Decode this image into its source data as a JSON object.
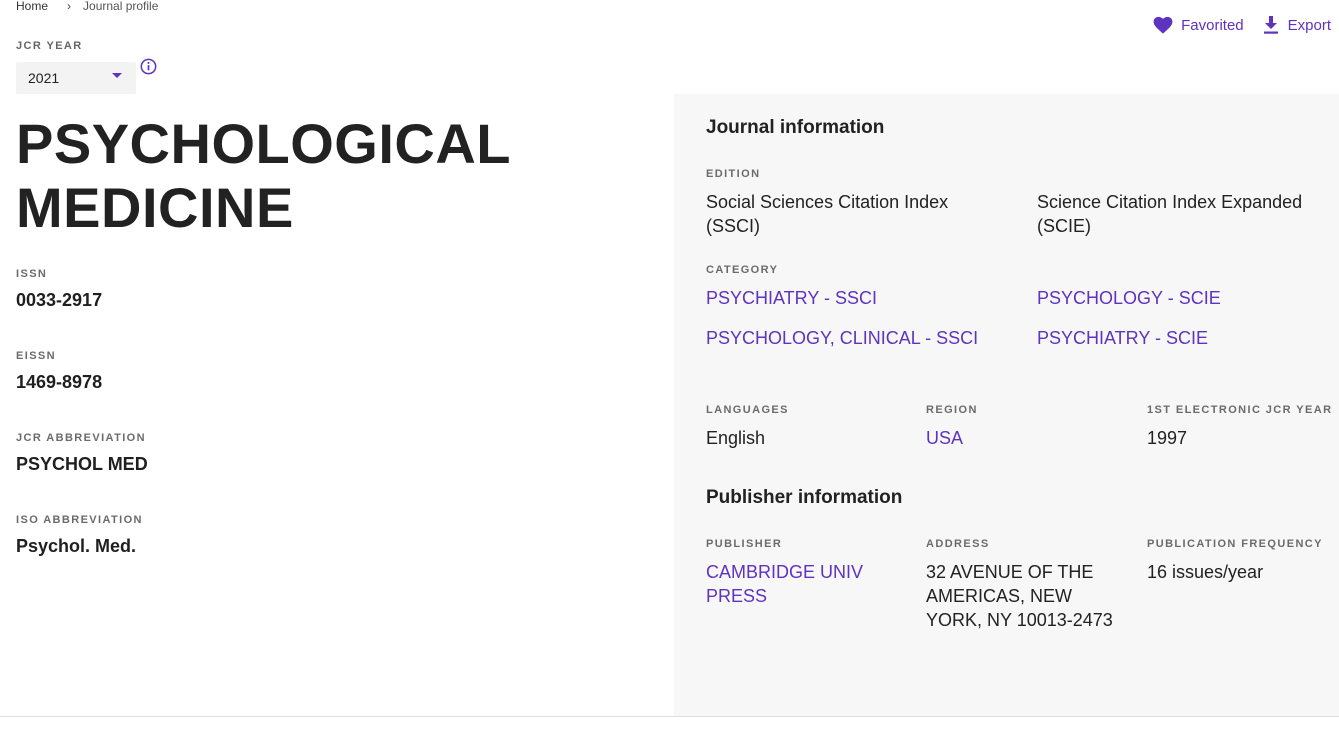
{
  "breadcrumb": {
    "home": "Home",
    "separator": "›",
    "current": "Journal profile"
  },
  "actions": {
    "favorited": "Favorited",
    "export": "Export"
  },
  "jcr_year": {
    "label": "JCR YEAR",
    "value": "2021"
  },
  "journal": {
    "title": "PSYCHOLOGICAL MEDICINE",
    "issn_label": "ISSN",
    "issn": "0033-2917",
    "eissn_label": "EISSN",
    "eissn": "1469-8978",
    "jcr_abbrev_label": "JCR ABBREVIATION",
    "jcr_abbrev": "PSYCHOL MED",
    "iso_abbrev_label": "ISO ABBREVIATION",
    "iso_abbrev": "Psychol. Med."
  },
  "journal_info": {
    "heading": "Journal information",
    "edition_label": "EDITION",
    "editions": [
      "Social Sciences Citation Index (SSCI)",
      "Science Citation Index Expanded (SCIE)"
    ],
    "category_label": "CATEGORY",
    "categories": [
      "PSYCHIATRY - SSCI",
      "PSYCHOLOGY - SCIE",
      "PSYCHOLOGY, CLINICAL - SSCI",
      "PSYCHIATRY - SCIE"
    ],
    "languages_label": "LANGUAGES",
    "languages": "English",
    "region_label": "REGION",
    "region": "USA",
    "first_year_label": "1ST ELECTRONIC JCR YEAR",
    "first_year": "1997"
  },
  "publisher_info": {
    "heading": "Publisher information",
    "publisher_label": "PUBLISHER",
    "publisher": "CAMBRIDGE UNIV PRESS",
    "address_label": "ADDRESS",
    "address": "32 AVENUE OF THE AMERICAS, NEW YORK, NY 10013-2473",
    "frequency_label": "PUBLICATION FREQUENCY",
    "frequency": "16 issues/year"
  },
  "colors": {
    "accent": "#5e33bf",
    "panel_bg": "#f7f7f7"
  }
}
